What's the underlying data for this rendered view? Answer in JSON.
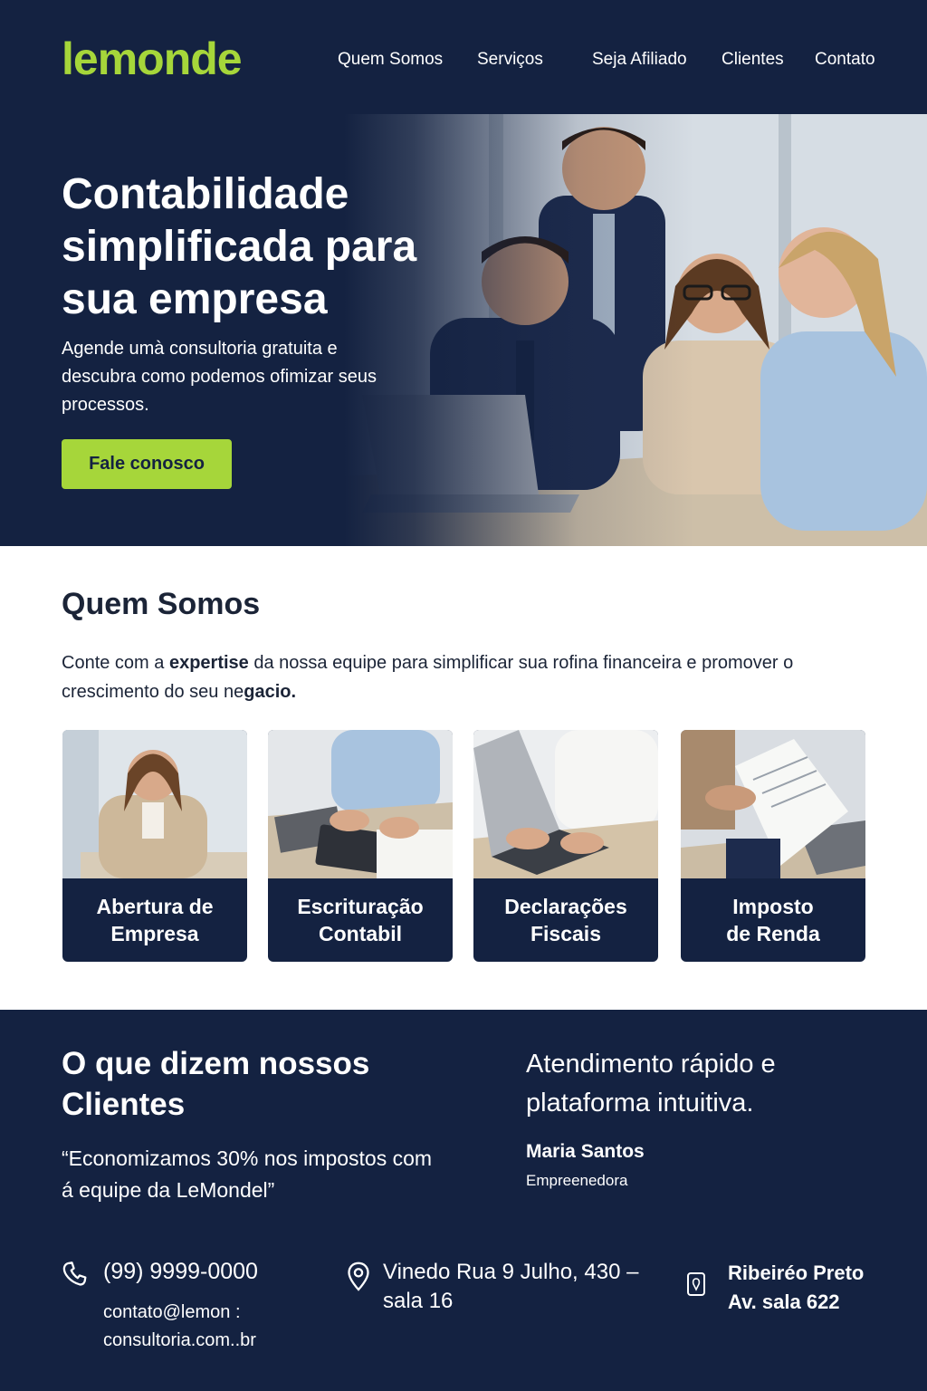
{
  "header": {
    "logo": "lemonde",
    "nav": [
      "Quem Somos",
      "Serviços",
      "Seja Afiliado",
      "Clientes",
      "Contato"
    ]
  },
  "hero": {
    "title": "Contabilidade simplificada para sua empresa",
    "subtitle": "Agende umà consultoria gratuita e descubra como podemos ofimizar seus processos.",
    "cta": "Fale conosco"
  },
  "about": {
    "title": "Quem Somos",
    "text_before": "Conte com a ",
    "text_bold": "expertise",
    "text_mid": " da nossa equipe para simplificar sua rofina financeira e promover o crescimento do seu ne",
    "text_bold2": "gacio."
  },
  "services": [
    {
      "line1": "Abertura de",
      "line2": "Empresa"
    },
    {
      "line1": "Escrituração",
      "line2": "Contabil"
    },
    {
      "line1": "Declarações",
      "line2": "Fiscais"
    },
    {
      "line1": "Imposto",
      "line2": "de Renda"
    }
  ],
  "testimonials": {
    "title": "O que dizem nossos Clientes",
    "quote": "“Economizamos 30% nos impostos com á equipe da LeMondel”",
    "right_text": "Atendimento rápido e plataforma intuitiva.",
    "name": "Maria Santos",
    "role": "Empreenedora"
  },
  "contact": {
    "phone": "(99) 9999-0000",
    "email": "contato@lemon : consultoria.com..br",
    "address1": "Vinedo  Rua 9 Julho, 430 – sala 16",
    "address2": "Ribeiréo Preto Av. sala 622"
  },
  "colors": {
    "navy": "#142241",
    "lime": "#a6d63a"
  }
}
